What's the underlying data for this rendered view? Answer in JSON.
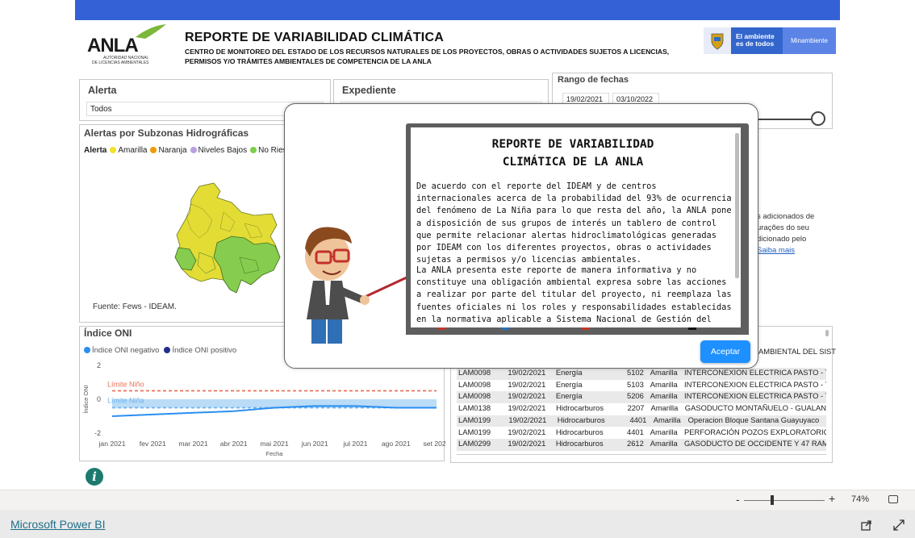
{
  "header": {
    "logo_text": "ANLA",
    "logo_subtext_1": "AUTORIDAD NACIONAL",
    "logo_subtext_2": "DE LICENCIAS AMBIENTALES",
    "title": "REPORTE DE VARIABILIDAD CLIMÁTICA",
    "subtitle": "CENTRO DE MONITOREO DEL ESTADO DE LOS RECURSOS NATURALES DE LOS PROYECTOS, OBRAS O ACTIVIDADES SUJETOS A LICENCIAS, PERMISOS Y/O TRÁMITES AMBIENTALES DE COMPETENCIA DE LA ANLA",
    "gov_text_1": "El ambiente",
    "gov_text_2": "es de todos",
    "gov_text_3": "Minambiente"
  },
  "slicers": {
    "alerta_title": "Alerta",
    "alerta_value": "Todos",
    "expediente_title": "Expediente",
    "fechas_title": "Rango de fechas",
    "fecha_inicio": "19/02/2021",
    "fecha_fin": "03/10/2022"
  },
  "map": {
    "title": "Alertas por Subzonas Hidrográficas",
    "legend_label": "Alerta",
    "legend": [
      {
        "label": "Amarilla",
        "color": "#f2e22a"
      },
      {
        "label": "Naranja",
        "color": "#ee9a00"
      },
      {
        "label": "Niveles Bajos",
        "color": "#b9a0e0"
      },
      {
        "label": "No Riesgo",
        "color": "#7ccf4a"
      }
    ],
    "source": "Fuente: Fews - IDEAM."
  },
  "oni": {
    "title": "Índice ONI",
    "legend": [
      {
        "label": "Índice ONI negativo",
        "color": "#2a8ff0"
      },
      {
        "label": "Índice ONI positivo",
        "color": "#1f2f8a"
      }
    ],
    "limit_nino": "Límite Niño",
    "limit_nina": "Límite Niña",
    "ylabel": "Índice ONI",
    "xlabel": "Fecha",
    "yticks": [
      "2",
      "0",
      "-2"
    ],
    "xticks": [
      "jan 2021",
      "fev 2021",
      "mar 2021",
      "abr 2021",
      "mai 2021",
      "jun 2021",
      "jul 2021",
      "ago 2021",
      "set 2021"
    ]
  },
  "chart_data": {
    "type": "line",
    "x": [
      "jan 2021",
      "fev 2021",
      "mar 2021",
      "abr 2021",
      "mai 2021",
      "jun 2021",
      "jul 2021",
      "ago 2021",
      "set 2021"
    ],
    "series": [
      {
        "name": "Índice ONI negativo",
        "values": [
          -1.0,
          -0.9,
          -0.8,
          -0.7,
          -0.5,
          -0.4,
          -0.4,
          -0.5,
          -0.5
        ]
      }
    ],
    "reference_lines": [
      {
        "label": "Límite Niño",
        "value": 0.5
      },
      {
        "label": "Límite Niña",
        "value": -0.5
      }
    ],
    "xlabel": "Fecha",
    "ylabel": "Índice ONI",
    "ylim": [
      -2,
      2
    ]
  },
  "table": {
    "header_partial": "AMBIENTAL DEL SIST",
    "rows": [
      [
        "LAM0098",
        "19/02/2021",
        "Energía",
        "5102",
        "Amarilla",
        "INTERCONEXION ELECTRICA PASTO - TU"
      ],
      [
        "LAM0098",
        "19/02/2021",
        "Energía",
        "5103",
        "Amarilla",
        "INTERCONEXION ELECTRICA PASTO - TU"
      ],
      [
        "LAM0098",
        "19/02/2021",
        "Energía",
        "5206",
        "Amarilla",
        "INTERCONEXION ELECTRICA PASTO - TU"
      ],
      [
        "LAM0138",
        "19/02/2021",
        "Hidrocarburos",
        "2207",
        "Amarilla",
        "GASODUCTO MONTAÑUELO - GUALAN"
      ],
      [
        "LAM0199",
        "19/02/2021",
        "Hidrocarburos",
        "4401",
        "Amarilla",
        "Operacion Bloque Santana Guayuyaco"
      ],
      [
        "LAM0199",
        "19/02/2021",
        "Hidrocarburos",
        "4401",
        "Amarilla",
        "PERFORACIÓN POZOS EXPLORATORIO I"
      ],
      [
        "LAM0299",
        "19/02/2021",
        "Hidrocarburos",
        "2612",
        "Amarilla",
        "GASODUCTO DE OCCIDENTE Y 47 RAM."
      ]
    ]
  },
  "background_text": {
    "line1": "s adicionados de",
    "line2": "urações do seu",
    "line3": "dicionado pelo",
    "link": "Saiba mais"
  },
  "modal": {
    "title_line1": "REPORTE DE VARIABILIDAD",
    "title_line2": "CLIMÁTICA DE LA ANLA",
    "paragraph1": "De acuerdo con el reporte del IDEAM y de centros internacionales acerca de la probabilidad del 93% de ocurrencia del fenómeno de La Niña para lo que resta del año, la ANLA pone a disposición de sus grupos de interés un tablero de control que permite relacionar alertas hidroclimatológicas generadas por IDEAM con los diferentes proyectos, obras o actividades sujetas a permisos y/o licencias ambientales.",
    "paragraph2": "La ANLA presenta este reporte de manera informativa y no constituye una obligación ambiental expresa sobre las acciones a realizar por parte del titular del proyecto, ni reemplaza las fuentes oficiales ni los roles y responsabilidades establecidas en la normativa aplicable a Sistema Nacional de Gestión del Riesgo, ni los roles y responsabilidades establecidas en la",
    "accept_label": "Aceptar"
  },
  "zoom": {
    "minus": "-",
    "plus": "+",
    "level": "74%"
  },
  "footer": {
    "link": "Microsoft Power BI"
  }
}
